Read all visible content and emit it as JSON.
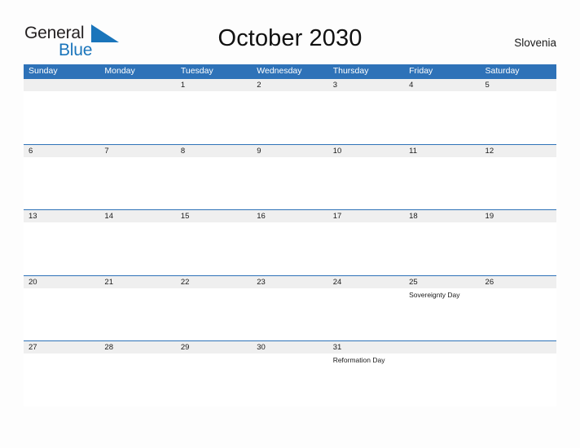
{
  "logo": {
    "word_top": "General",
    "word_bottom": "Blue",
    "flag_icon": "blue-triangle-flag",
    "color_dark": "#231f20",
    "color_blue": "#1a75bb"
  },
  "header": {
    "title": "October 2030",
    "region": "Slovenia"
  },
  "theme": {
    "header_blue": "#2e72b8",
    "row_rule_blue": "#2e72b8",
    "date_band_gray": "#efefef",
    "page_background": "#fdfdfd"
  },
  "calendar": {
    "month": "October",
    "year": "2030",
    "weekday_headers": [
      "Sunday",
      "Monday",
      "Tuesday",
      "Wednesday",
      "Thursday",
      "Friday",
      "Saturday"
    ],
    "weeks": [
      {
        "days": [
          {
            "number": "",
            "events": []
          },
          {
            "number": "",
            "events": []
          },
          {
            "number": "1",
            "events": []
          },
          {
            "number": "2",
            "events": []
          },
          {
            "number": "3",
            "events": []
          },
          {
            "number": "4",
            "events": []
          },
          {
            "number": "5",
            "events": []
          }
        ]
      },
      {
        "days": [
          {
            "number": "6",
            "events": []
          },
          {
            "number": "7",
            "events": []
          },
          {
            "number": "8",
            "events": []
          },
          {
            "number": "9",
            "events": []
          },
          {
            "number": "10",
            "events": []
          },
          {
            "number": "11",
            "events": []
          },
          {
            "number": "12",
            "events": []
          }
        ]
      },
      {
        "days": [
          {
            "number": "13",
            "events": []
          },
          {
            "number": "14",
            "events": []
          },
          {
            "number": "15",
            "events": []
          },
          {
            "number": "16",
            "events": []
          },
          {
            "number": "17",
            "events": []
          },
          {
            "number": "18",
            "events": []
          },
          {
            "number": "19",
            "events": []
          }
        ]
      },
      {
        "days": [
          {
            "number": "20",
            "events": []
          },
          {
            "number": "21",
            "events": []
          },
          {
            "number": "22",
            "events": []
          },
          {
            "number": "23",
            "events": []
          },
          {
            "number": "24",
            "events": []
          },
          {
            "number": "25",
            "events": [
              "Sovereignty Day"
            ]
          },
          {
            "number": "26",
            "events": []
          }
        ]
      },
      {
        "days": [
          {
            "number": "27",
            "events": []
          },
          {
            "number": "28",
            "events": []
          },
          {
            "number": "29",
            "events": []
          },
          {
            "number": "30",
            "events": []
          },
          {
            "number": "31",
            "events": [
              "Reformation Day"
            ]
          },
          {
            "number": "",
            "events": []
          },
          {
            "number": "",
            "events": []
          }
        ]
      }
    ]
  }
}
